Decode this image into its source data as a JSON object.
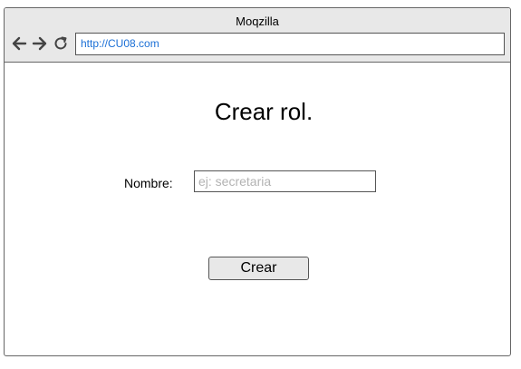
{
  "browser": {
    "title": "Moqzilla",
    "url": "http://CU08.com",
    "url_color": "#1a6fd6",
    "nav_icons": [
      "arrow-left-icon",
      "arrow-right-icon",
      "reload-icon"
    ]
  },
  "page": {
    "heading": "Crear rol.",
    "form": {
      "name_label": "Nombre:",
      "name_placeholder": "ej: secretaria",
      "name_value": "",
      "submit_label": "Crear"
    }
  }
}
